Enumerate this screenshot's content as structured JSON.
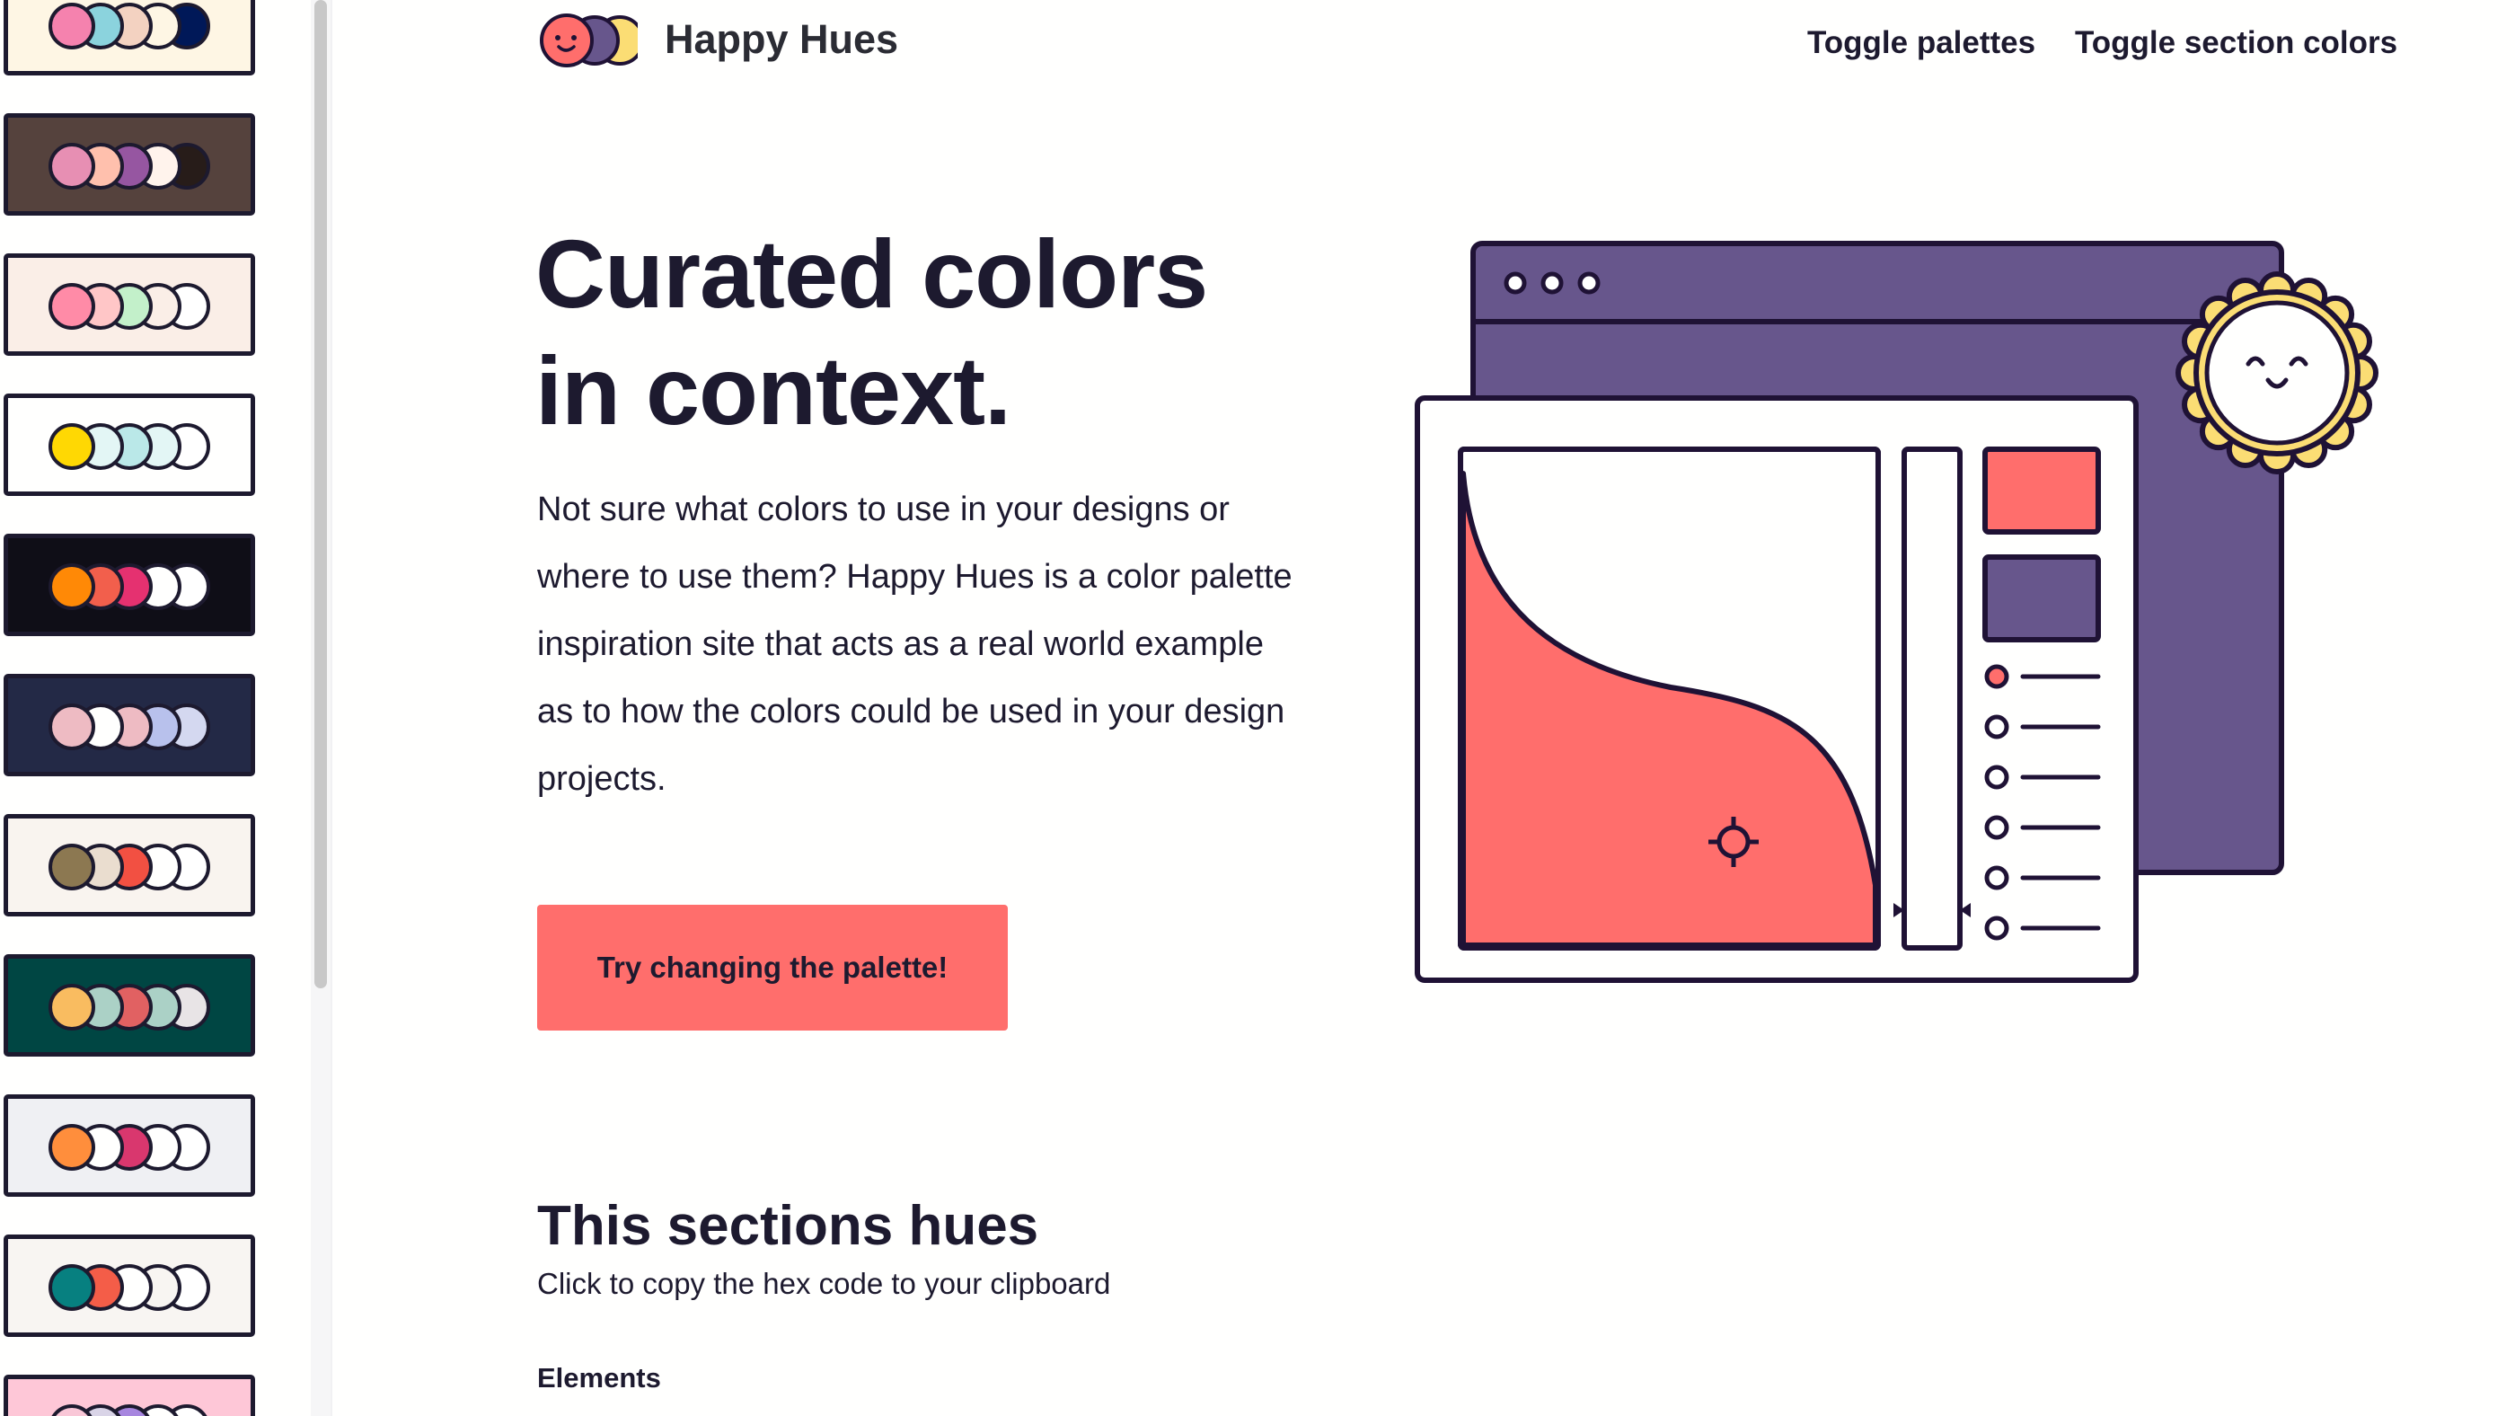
{
  "header": {
    "site_title": "Happy Hues",
    "logo_icon": "happy-hues-logo-icon",
    "nav": [
      {
        "label": "Toggle palettes"
      },
      {
        "label": "Toggle section colors"
      }
    ]
  },
  "hero": {
    "heading_line1": "Curated colors",
    "heading_line2": "in context.",
    "body": "Not sure what colors to use in your designs or where to use them? Happy Hues is a color palette inspiration site that acts as a real world example as to how the colors could be used in your design projects.",
    "cta_label": "Try changing the palette!"
  },
  "section": {
    "heading": "This sections hues",
    "subtitle": "Click to copy the hex code to your clipboard",
    "elements_label": "Elements"
  },
  "sidebar": {
    "palettes": [
      {
        "background": "#fef6e4",
        "colors": [
          "#f582ae",
          "#8bd3dd",
          "#f3d2c1",
          "#fef6e4",
          "#001858"
        ]
      },
      {
        "background": "#55423d",
        "colors": [
          "#e78fb3",
          "#ffc0ad",
          "#9656a1",
          "#fff3ec",
          "#271c19"
        ]
      },
      {
        "background": "#faeee7",
        "colors": [
          "#ff8ba7",
          "#ffc6c7",
          "#c3f0ca",
          "#faeee7",
          "#ffffff"
        ]
      },
      {
        "background": "#fffffe",
        "colors": [
          "#ffd803",
          "#e3f6f5",
          "#bae8e8",
          "#e3f6f5",
          "#ffffff"
        ]
      },
      {
        "background": "#0f0e17",
        "colors": [
          "#ff8906",
          "#f25f4c",
          "#e53170",
          "#fffffe",
          "#ffffff"
        ]
      },
      {
        "background": "#232946",
        "colors": [
          "#eebbc3",
          "#fffffe",
          "#eebbc3",
          "#b8c1ec",
          "#d4d8f0"
        ]
      },
      {
        "background": "#f9f4ef",
        "colors": [
          "#8c7851",
          "#eaddcf",
          "#f25042",
          "#fffffe",
          "#ffffff"
        ]
      },
      {
        "background": "#004643",
        "colors": [
          "#f9bc60",
          "#abd1c6",
          "#e16162",
          "#abd1c6",
          "#e8e4e6"
        ]
      },
      {
        "background": "#eff0f3",
        "colors": [
          "#ff8e3c",
          "#fffffe",
          "#d9376e",
          "#fffffe",
          "#ffffff"
        ]
      },
      {
        "background": "#f8f5f2",
        "colors": [
          "#078080",
          "#f45d48",
          "#fffffe",
          "#f8f5f2",
          "#ffffff"
        ]
      },
      {
        "background": "#fec7d7",
        "colors": [
          "#f9c7d7",
          "#d9d4e7",
          "#a786df",
          "#fffffe",
          "#ffffff"
        ]
      }
    ]
  },
  "colors": {
    "headline": "#1d1a2f",
    "button": "#ff6e6c",
    "illustration_main": "#67568c",
    "illustration_highlight": "#ff6e6c",
    "stroke": "#1f1235",
    "sun": "#fbdd74"
  }
}
